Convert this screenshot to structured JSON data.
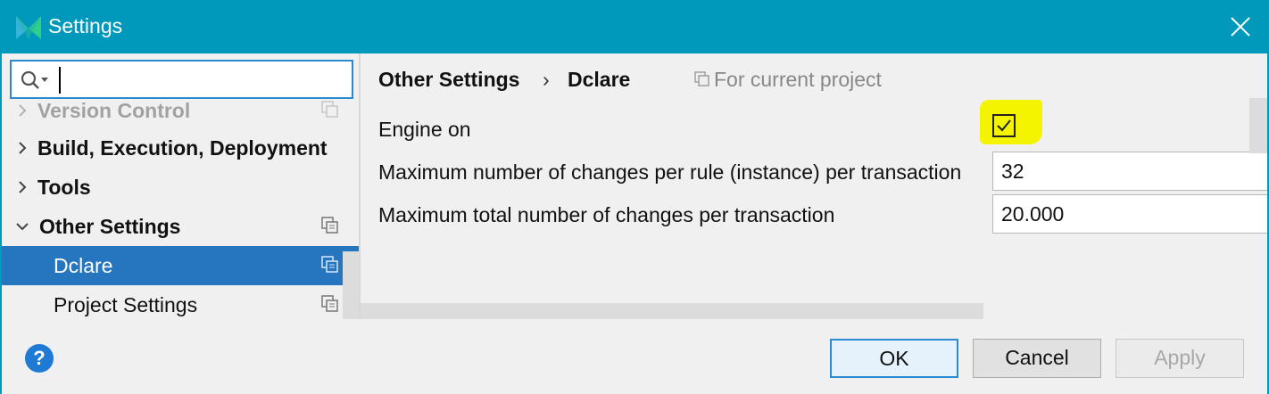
{
  "window": {
    "title": "Settings",
    "close_label": "close-icon"
  },
  "search": {
    "placeholder": "",
    "value": ""
  },
  "sidebar": {
    "items": [
      {
        "label": "Version Control",
        "bold": true,
        "expandable": true,
        "expanded": false,
        "has_copy_icon": true,
        "partially_hidden": true
      },
      {
        "label": "Build, Execution, Deployment",
        "bold": true,
        "expandable": true,
        "expanded": false,
        "has_copy_icon": false
      },
      {
        "label": "Tools",
        "bold": true,
        "expandable": true,
        "expanded": false,
        "has_copy_icon": false
      },
      {
        "label": "Other Settings",
        "bold": true,
        "expandable": true,
        "expanded": true,
        "has_copy_icon": true
      },
      {
        "label": "Dclare",
        "bold": false,
        "expandable": false,
        "selected": true,
        "has_copy_icon": true
      },
      {
        "label": "Project Settings",
        "bold": false,
        "expandable": false,
        "has_copy_icon": true
      }
    ]
  },
  "breadcrumb": {
    "parent": "Other Settings",
    "separator": "›",
    "current": "Dclare",
    "scope": "For current project"
  },
  "settings": {
    "engine_on": {
      "label": "Engine on",
      "checked": true,
      "highlight_color": "#f4f400"
    },
    "max_changes_rule": {
      "label": "Maximum number of changes per rule (instance) per transaction",
      "value": "32"
    },
    "max_changes_total": {
      "label": "Maximum total number of changes per transaction",
      "value": "20.000"
    }
  },
  "footer": {
    "help": "?",
    "ok": "OK",
    "cancel": "Cancel",
    "apply": "Apply"
  },
  "colors": {
    "titlebar": "#0099bb",
    "selection": "#2675bf",
    "focus_border": "#2a8bd0",
    "help_icon": "#1f7ad6"
  }
}
